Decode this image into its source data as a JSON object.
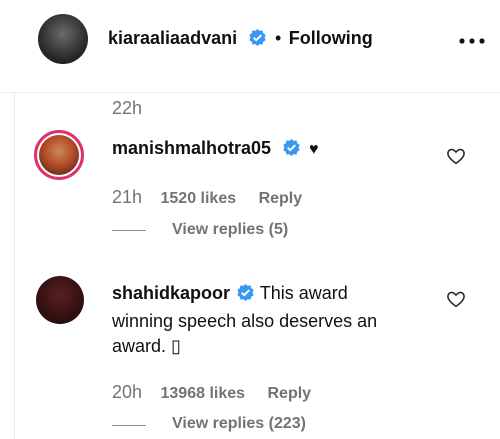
{
  "post_header": {
    "username": "kiaraaliaadvani",
    "separator": "•",
    "follow_status": "Following",
    "more_icon": "more-horizontal-icon"
  },
  "caption_time": "22h",
  "comments": [
    {
      "username": "manishmalhotra05",
      "text": "",
      "extra_symbol": "♥",
      "time": "21h",
      "likes": "1520 likes",
      "reply_label": "Reply",
      "view_replies": "View replies (5)"
    },
    {
      "username": "shahidkapoor",
      "text": "This award",
      "text_line2": "winning speech also deserves an",
      "text_line3": "award. ▯",
      "time": "20h",
      "likes": "13968 likes",
      "reply_label": "Reply",
      "view_replies": "View replies (223)"
    }
  ],
  "colors": {
    "verified": "#3897f0",
    "muted": "#737373",
    "story_ring": "#e1306c"
  }
}
